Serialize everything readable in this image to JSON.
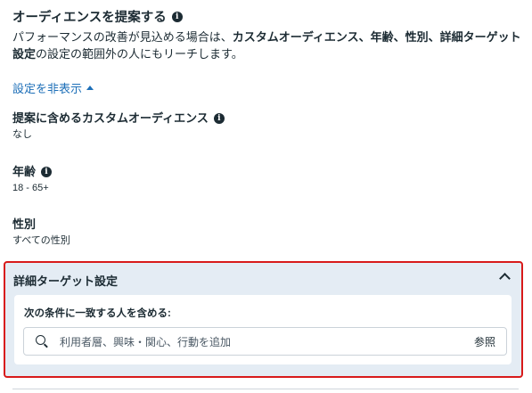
{
  "suggest": {
    "title": "オーディエンスを提案する",
    "desc_prefix": "パフォーマンスの改善が見込める場合は、",
    "desc_bold": "カスタムオーディエンス、年齢、性別、詳細ターゲット設定",
    "desc_suffix": "の設定の範囲外の人にもリーチします。"
  },
  "toggle": {
    "label": "設定を非表示"
  },
  "fields": {
    "custom_audience": {
      "label": "提案に含めるカスタムオーディエンス",
      "value": "なし"
    },
    "age": {
      "label": "年齢",
      "value": "18 - 65+"
    },
    "gender": {
      "label": "性別",
      "value": "すべての性別"
    }
  },
  "detail": {
    "title": "詳細ターゲット設定",
    "inner_label": "次の条件に一致する人を含める:",
    "search_placeholder": "利用者層、興味・関心、行動を追加",
    "browse_label": "参照"
  },
  "icons": {
    "info": "info-icon",
    "caret": "caret-up-icon",
    "collapse": "chevron-up-icon",
    "search": "search-icon"
  },
  "colors": {
    "link": "#1d6fb8",
    "highlight_border": "#d81a1a",
    "section_bg": "#e4ecf4",
    "text": "#1c2b33"
  }
}
